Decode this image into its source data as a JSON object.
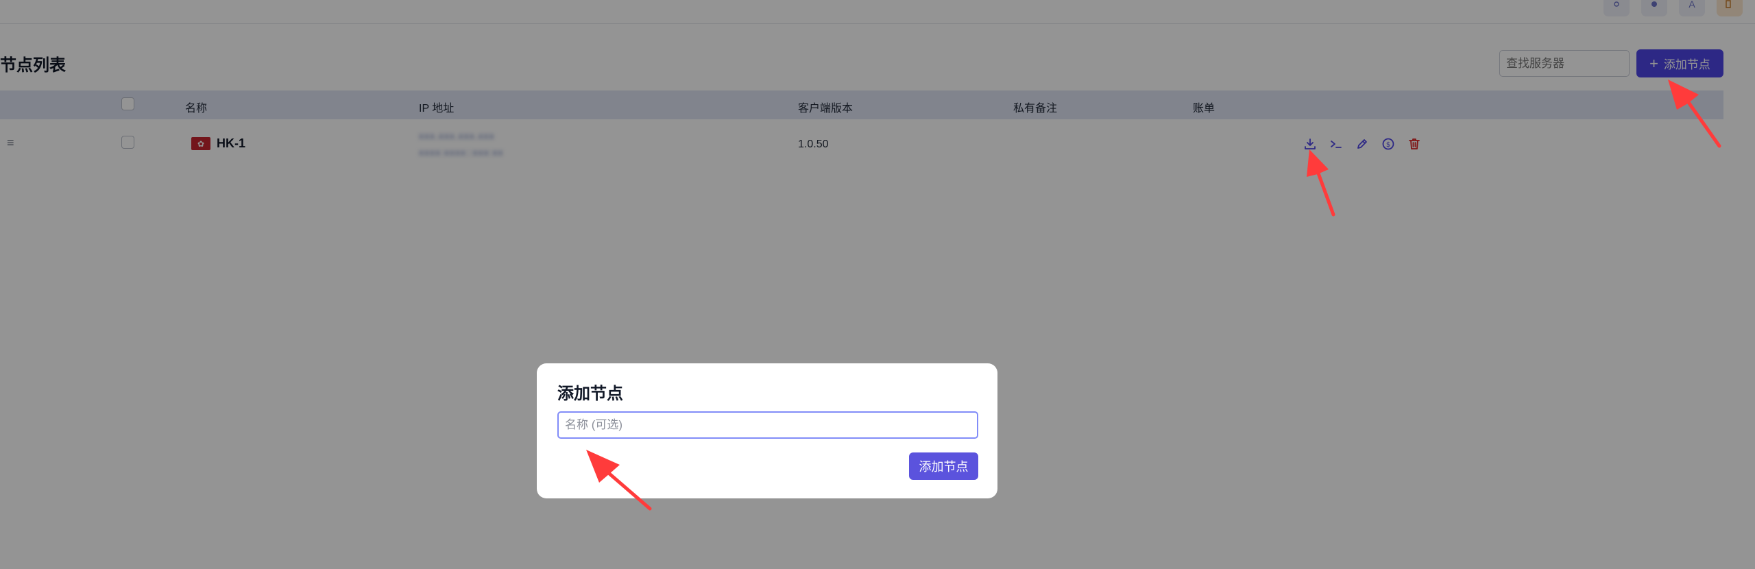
{
  "topbar": {
    "buttons": [
      {
        "name": "theme-toggle-button",
        "icon": "sun-icon"
      },
      {
        "name": "color-scheme-button",
        "icon": "palette-icon"
      },
      {
        "name": "language-button",
        "icon": "translate-icon"
      },
      {
        "name": "logout-button",
        "icon": "logout-icon"
      }
    ]
  },
  "page": {
    "title": "节点列表",
    "search_placeholder": "查找服务器",
    "add_button_label": "添加节点"
  },
  "table": {
    "headers": {
      "name": "名称",
      "ip": "IP 地址",
      "client_version": "客户端版本",
      "private_note": "私有备注",
      "billing": "账单"
    },
    "rows": [
      {
        "name": "HK-1",
        "flag": "hong-kong-flag",
        "ip_line1": "xxx.xxx.xxx.xxx",
        "ip_line2": "xxxx:xxxx::xxx:xx",
        "client_version": "1.0.50",
        "private_note": "",
        "billing": "",
        "actions": [
          "download-icon",
          "terminal-icon",
          "edit-icon",
          "billing-icon",
          "delete-icon"
        ]
      }
    ]
  },
  "modal": {
    "title": "添加节点",
    "input_placeholder": "名称 (可选)",
    "submit_label": "添加节点"
  },
  "colors": {
    "accent": "#4f46e5",
    "header_bg": "#dfe3f3",
    "danger": "#dc2626",
    "annotation": "#ff3b3b"
  }
}
